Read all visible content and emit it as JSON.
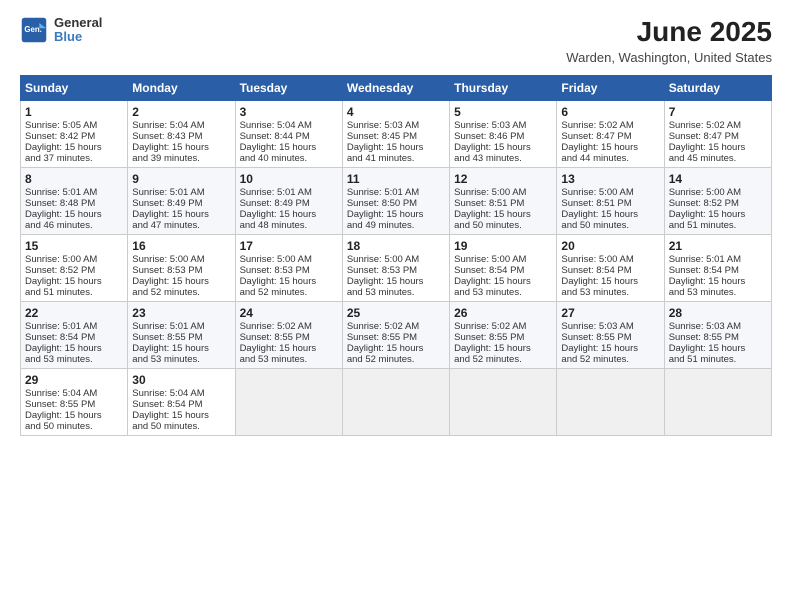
{
  "header": {
    "logo": {
      "line1": "General",
      "line2": "Blue"
    },
    "title": "June 2025",
    "location": "Warden, Washington, United States"
  },
  "weekdays": [
    "Sunday",
    "Monday",
    "Tuesday",
    "Wednesday",
    "Thursday",
    "Friday",
    "Saturday"
  ],
  "weeks": [
    [
      {
        "day": "1",
        "lines": [
          "Sunrise: 5:05 AM",
          "Sunset: 8:42 PM",
          "Daylight: 15 hours",
          "and 37 minutes."
        ]
      },
      {
        "day": "2",
        "lines": [
          "Sunrise: 5:04 AM",
          "Sunset: 8:43 PM",
          "Daylight: 15 hours",
          "and 39 minutes."
        ]
      },
      {
        "day": "3",
        "lines": [
          "Sunrise: 5:04 AM",
          "Sunset: 8:44 PM",
          "Daylight: 15 hours",
          "and 40 minutes."
        ]
      },
      {
        "day": "4",
        "lines": [
          "Sunrise: 5:03 AM",
          "Sunset: 8:45 PM",
          "Daylight: 15 hours",
          "and 41 minutes."
        ]
      },
      {
        "day": "5",
        "lines": [
          "Sunrise: 5:03 AM",
          "Sunset: 8:46 PM",
          "Daylight: 15 hours",
          "and 43 minutes."
        ]
      },
      {
        "day": "6",
        "lines": [
          "Sunrise: 5:02 AM",
          "Sunset: 8:47 PM",
          "Daylight: 15 hours",
          "and 44 minutes."
        ]
      },
      {
        "day": "7",
        "lines": [
          "Sunrise: 5:02 AM",
          "Sunset: 8:47 PM",
          "Daylight: 15 hours",
          "and 45 minutes."
        ]
      }
    ],
    [
      {
        "day": "8",
        "lines": [
          "Sunrise: 5:01 AM",
          "Sunset: 8:48 PM",
          "Daylight: 15 hours",
          "and 46 minutes."
        ]
      },
      {
        "day": "9",
        "lines": [
          "Sunrise: 5:01 AM",
          "Sunset: 8:49 PM",
          "Daylight: 15 hours",
          "and 47 minutes."
        ]
      },
      {
        "day": "10",
        "lines": [
          "Sunrise: 5:01 AM",
          "Sunset: 8:49 PM",
          "Daylight: 15 hours",
          "and 48 minutes."
        ]
      },
      {
        "day": "11",
        "lines": [
          "Sunrise: 5:01 AM",
          "Sunset: 8:50 PM",
          "Daylight: 15 hours",
          "and 49 minutes."
        ]
      },
      {
        "day": "12",
        "lines": [
          "Sunrise: 5:00 AM",
          "Sunset: 8:51 PM",
          "Daylight: 15 hours",
          "and 50 minutes."
        ]
      },
      {
        "day": "13",
        "lines": [
          "Sunrise: 5:00 AM",
          "Sunset: 8:51 PM",
          "Daylight: 15 hours",
          "and 50 minutes."
        ]
      },
      {
        "day": "14",
        "lines": [
          "Sunrise: 5:00 AM",
          "Sunset: 8:52 PM",
          "Daylight: 15 hours",
          "and 51 minutes."
        ]
      }
    ],
    [
      {
        "day": "15",
        "lines": [
          "Sunrise: 5:00 AM",
          "Sunset: 8:52 PM",
          "Daylight: 15 hours",
          "and 51 minutes."
        ]
      },
      {
        "day": "16",
        "lines": [
          "Sunrise: 5:00 AM",
          "Sunset: 8:53 PM",
          "Daylight: 15 hours",
          "and 52 minutes."
        ]
      },
      {
        "day": "17",
        "lines": [
          "Sunrise: 5:00 AM",
          "Sunset: 8:53 PM",
          "Daylight: 15 hours",
          "and 52 minutes."
        ]
      },
      {
        "day": "18",
        "lines": [
          "Sunrise: 5:00 AM",
          "Sunset: 8:53 PM",
          "Daylight: 15 hours",
          "and 53 minutes."
        ]
      },
      {
        "day": "19",
        "lines": [
          "Sunrise: 5:00 AM",
          "Sunset: 8:54 PM",
          "Daylight: 15 hours",
          "and 53 minutes."
        ]
      },
      {
        "day": "20",
        "lines": [
          "Sunrise: 5:00 AM",
          "Sunset: 8:54 PM",
          "Daylight: 15 hours",
          "and 53 minutes."
        ]
      },
      {
        "day": "21",
        "lines": [
          "Sunrise: 5:01 AM",
          "Sunset: 8:54 PM",
          "Daylight: 15 hours",
          "and 53 minutes."
        ]
      }
    ],
    [
      {
        "day": "22",
        "lines": [
          "Sunrise: 5:01 AM",
          "Sunset: 8:54 PM",
          "Daylight: 15 hours",
          "and 53 minutes."
        ]
      },
      {
        "day": "23",
        "lines": [
          "Sunrise: 5:01 AM",
          "Sunset: 8:55 PM",
          "Daylight: 15 hours",
          "and 53 minutes."
        ]
      },
      {
        "day": "24",
        "lines": [
          "Sunrise: 5:02 AM",
          "Sunset: 8:55 PM",
          "Daylight: 15 hours",
          "and 53 minutes."
        ]
      },
      {
        "day": "25",
        "lines": [
          "Sunrise: 5:02 AM",
          "Sunset: 8:55 PM",
          "Daylight: 15 hours",
          "and 52 minutes."
        ]
      },
      {
        "day": "26",
        "lines": [
          "Sunrise: 5:02 AM",
          "Sunset: 8:55 PM",
          "Daylight: 15 hours",
          "and 52 minutes."
        ]
      },
      {
        "day": "27",
        "lines": [
          "Sunrise: 5:03 AM",
          "Sunset: 8:55 PM",
          "Daylight: 15 hours",
          "and 52 minutes."
        ]
      },
      {
        "day": "28",
        "lines": [
          "Sunrise: 5:03 AM",
          "Sunset: 8:55 PM",
          "Daylight: 15 hours",
          "and 51 minutes."
        ]
      }
    ],
    [
      {
        "day": "29",
        "lines": [
          "Sunrise: 5:04 AM",
          "Sunset: 8:55 PM",
          "Daylight: 15 hours",
          "and 50 minutes."
        ]
      },
      {
        "day": "30",
        "lines": [
          "Sunrise: 5:04 AM",
          "Sunset: 8:54 PM",
          "Daylight: 15 hours",
          "and 50 minutes."
        ]
      },
      null,
      null,
      null,
      null,
      null
    ]
  ]
}
